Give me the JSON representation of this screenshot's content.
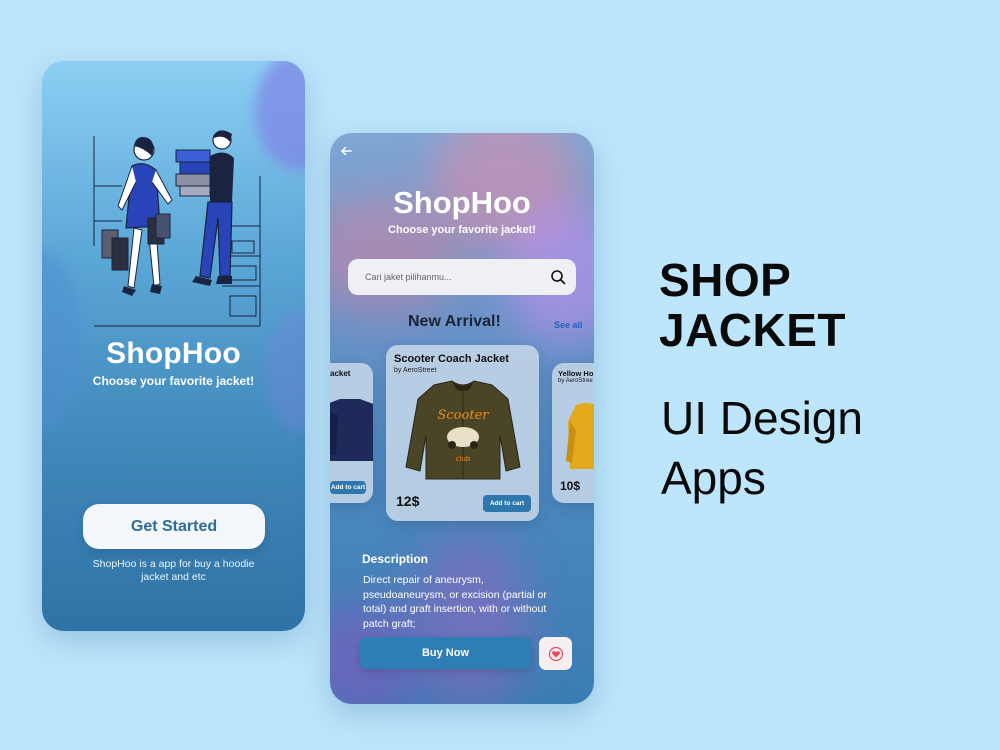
{
  "colors": {
    "background": "#bde5fb",
    "primary_button": "#2f7db5",
    "heart": "#e24a5d"
  },
  "onboarding": {
    "brand": "ShopHoo",
    "tagline": "Choose your favorite jacket!",
    "cta_label": "Get Started",
    "description": "ShopHoo is a app for buy a hoodie jacket and etc"
  },
  "product_screen": {
    "back_icon": "arrow-left-icon",
    "brand": "ShopHoo",
    "tagline": "Choose your favorite jacket!",
    "search": {
      "placeholder": "Cari jaket pilihanmu...",
      "icon": "search-icon"
    },
    "section_title": "New Arrival!",
    "see_all_label": "See all",
    "cards": [
      {
        "title": "acket",
        "brand": "",
        "price": "",
        "add_label": "Add to cart"
      },
      {
        "title": "Scooter Coach Jacket",
        "brand": "by AeroStreet",
        "price": "12$",
        "add_label": "Add to cart"
      },
      {
        "title": "Yellow Ho",
        "brand": "by AeroStree",
        "price": "10$",
        "add_label": ""
      }
    ],
    "description_title": "Description",
    "description_body": "Direct repair of aneurysm, pseudoaneurysm, or excision (partial or total) and graft insertion, with or without patch graft;",
    "buy_label": "Buy Now",
    "fav_icon": "heart-icon"
  },
  "headline": {
    "line1": "SHOP",
    "line2": "JACKET",
    "sub1": "UI Design",
    "sub2": "Apps"
  }
}
